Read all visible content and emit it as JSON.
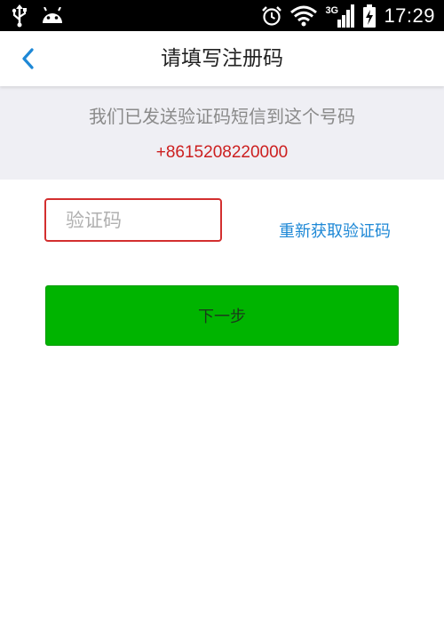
{
  "status_bar": {
    "network_label": "3G",
    "time": "17:29",
    "icons": [
      "usb-icon",
      "android-icon",
      "alarm-icon",
      "wifi-icon",
      "signal-icon",
      "battery-icon"
    ]
  },
  "header": {
    "back_icon": "chevron-left-icon",
    "title": "请填写注册码"
  },
  "info": {
    "message": "我们已发送验证码短信到这个号码",
    "phone": "+8615208220000"
  },
  "form": {
    "code_input": {
      "value": "",
      "placeholder": "验证码"
    },
    "resend_label": "重新获取验证码",
    "next_label": "下一步"
  },
  "colors": {
    "accent_blue": "#1e88d6",
    "phone_red": "#cc1f1f",
    "button_green": "#00b400",
    "input_border": "#d32f2f",
    "panel_bg": "#efeff4"
  }
}
